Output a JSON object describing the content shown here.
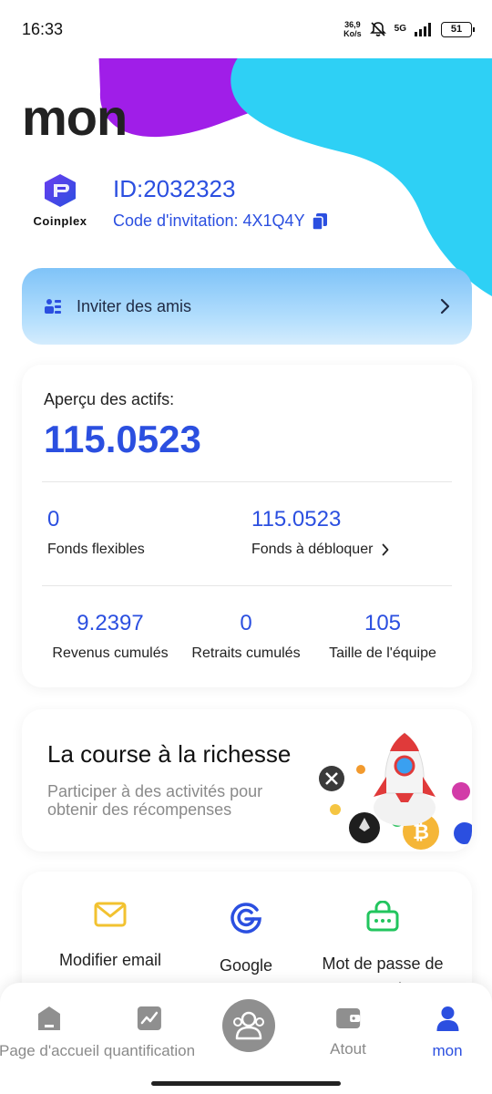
{
  "status_bar": {
    "time": "16:33",
    "speed_value": "36,9",
    "speed_unit": "Ko/s",
    "network": "5G",
    "battery": "51"
  },
  "page": {
    "title": "mon"
  },
  "profile": {
    "logo_text": "Coinplex",
    "id": "ID:2032323",
    "invite_code": "Code d'invitation: 4X1Q4Y"
  },
  "invite_banner": {
    "label": "Inviter des amis"
  },
  "assets": {
    "title": "Aperçu des actifs:",
    "total": "115.0523",
    "flexible_value": "0",
    "flexible_label": "Fonds flexibles",
    "unlock_value": "115.0523",
    "unlock_label": "Fonds à débloquer",
    "revenue_value": "9.2397",
    "revenue_label": "Revenus cumulés",
    "withdrawals_value": "0",
    "withdrawals_label": "Retraits cumulés",
    "team_value": "105",
    "team_label": "Taille de l'équipe"
  },
  "race": {
    "title": "La course à la richesse",
    "subtitle": "Participer à des activités pour obtenir des récompenses"
  },
  "security": {
    "email_label": "Modifier email",
    "google_label": "Google Authenticateur",
    "password_label": "Mot de passe de connexion"
  },
  "bottom_nav": {
    "home": "Page d'accueil",
    "quant": "quantification",
    "atout": "Atout",
    "mon": "mon"
  },
  "colors": {
    "accent": "#2b4fe0",
    "purple_blob": "#a01ee8",
    "cyan_blob": "#2ed0f5",
    "email_icon": "#f2c230",
    "password_icon": "#22c55e"
  }
}
